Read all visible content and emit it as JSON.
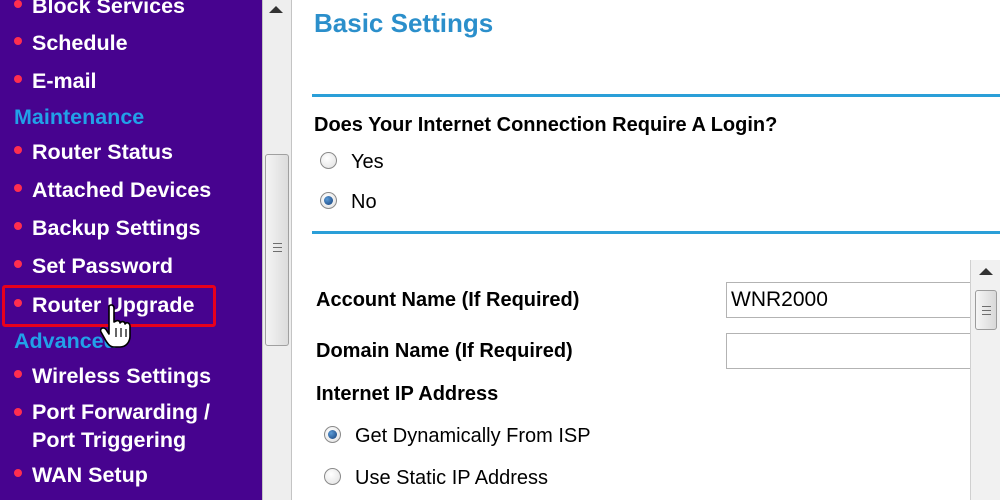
{
  "sidebar": {
    "items_top": [
      {
        "label": "Block Services"
      },
      {
        "label": "Schedule"
      },
      {
        "label": "E-mail"
      }
    ],
    "maintenance_heading": "Maintenance",
    "maintenance_items": [
      {
        "label": "Router Status"
      },
      {
        "label": "Attached Devices"
      },
      {
        "label": "Backup Settings"
      },
      {
        "label": "Set Password"
      },
      {
        "label": "Router Upgrade",
        "highlighted": true
      }
    ],
    "advanced_heading": "Advanced",
    "advanced_items": [
      {
        "label": "Wireless Settings"
      },
      {
        "label_line1": "Port Forwarding /",
        "label_line2": "Port Triggering"
      },
      {
        "label": "WAN Setup"
      }
    ],
    "colors": {
      "background": "#47038f",
      "section_heading": "#22a0e8",
      "bullet": "#ff2e4f",
      "highlight": "#e8001c"
    }
  },
  "main": {
    "title": "Basic Settings",
    "question": "Does Your Internet Connection Require A Login?",
    "login_options": [
      {
        "label": "Yes",
        "checked": false
      },
      {
        "label": "No",
        "checked": true
      }
    ],
    "account_name": {
      "label": "Account Name (If Required)",
      "value": "WNR2000"
    },
    "domain_name": {
      "label": "Domain Name (If Required)",
      "value": ""
    },
    "ip_section": {
      "label": "Internet IP Address",
      "options": [
        {
          "label": "Get Dynamically From ISP",
          "checked": true
        },
        {
          "label": "Use Static IP Address",
          "checked": false
        }
      ]
    },
    "colors": {
      "title": "#2b8fcb",
      "rule": "#2a9fd8"
    }
  },
  "icons": {
    "cursor": "hand-pointer-icon"
  }
}
